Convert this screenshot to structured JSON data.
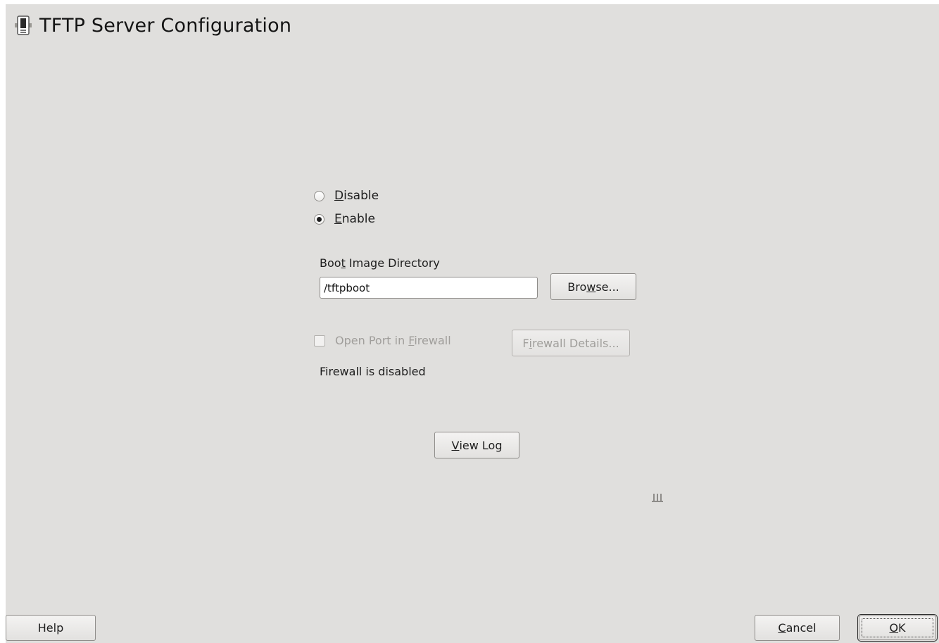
{
  "window": {
    "title": "TFTP Server Configuration",
    "icon": "tftp-server-icon"
  },
  "service": {
    "options": [
      {
        "label_pre": "",
        "mnemonic": "D",
        "label_post": "isable",
        "selected": false
      },
      {
        "label_pre": "",
        "mnemonic": "E",
        "label_post": "nable",
        "selected": true
      }
    ]
  },
  "boot_dir": {
    "label_pre": "Boo",
    "mnemonic": "t",
    "label_post": " Image Directory",
    "value": "/tftpboot",
    "browse_pre": "Bro",
    "browse_mnemonic": "w",
    "browse_post": "se..."
  },
  "firewall": {
    "open_port_pre": "Open Port in ",
    "open_port_mnemonic": "F",
    "open_port_post": "irewall",
    "open_port_checked": false,
    "open_port_enabled": false,
    "details_pre": "F",
    "details_mnemonic": "i",
    "details_post": "rewall Details...",
    "details_enabled": false,
    "status": "Firewall is disabled"
  },
  "view_log": {
    "mnemonic": "V",
    "label_post": "iew Log"
  },
  "footer": {
    "help_label": "Help",
    "cancel_mnemonic": "C",
    "cancel_post": "ancel",
    "ok_mnemonic": "O",
    "ok_post": "K"
  },
  "colors": {
    "dialog_bg": "#e0dfdd",
    "text": "#1e1e1e",
    "disabled_text": "#a09e9b"
  }
}
